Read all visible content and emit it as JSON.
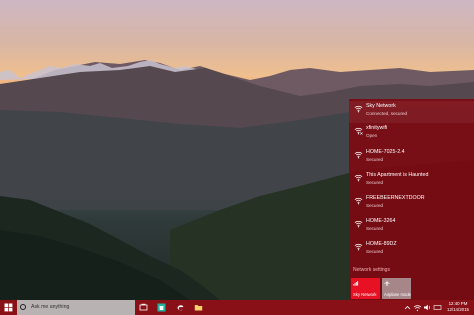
{
  "network_flyout": {
    "networks": [
      {
        "name": "Sky Network",
        "status": "Connected, secured"
      },
      {
        "name": "xfinitywifi",
        "status": "Open"
      },
      {
        "name": "HOME-7025-2.4",
        "status": "Secured"
      },
      {
        "name": "This Apartment is Haunted",
        "status": "Secured"
      },
      {
        "name": "FREEBEERNEXTDOOR",
        "status": "Secured"
      },
      {
        "name": "HOME-3264",
        "status": "Secured"
      },
      {
        "name": "HOME-89DZ",
        "status": "Secured"
      }
    ],
    "settings_link": "Network settings",
    "tiles": {
      "wifi_label": "Sky Network",
      "airplane_label": "Airplane mode"
    }
  },
  "taskbar": {
    "search_placeholder": "Ask me anything",
    "clock_time": "12:40 PM",
    "clock_date": "12/14/2015"
  },
  "colors": {
    "flyout_bg": "#7d0a12",
    "accent": "#e81123",
    "taskbar_bg": "#8a1018"
  }
}
